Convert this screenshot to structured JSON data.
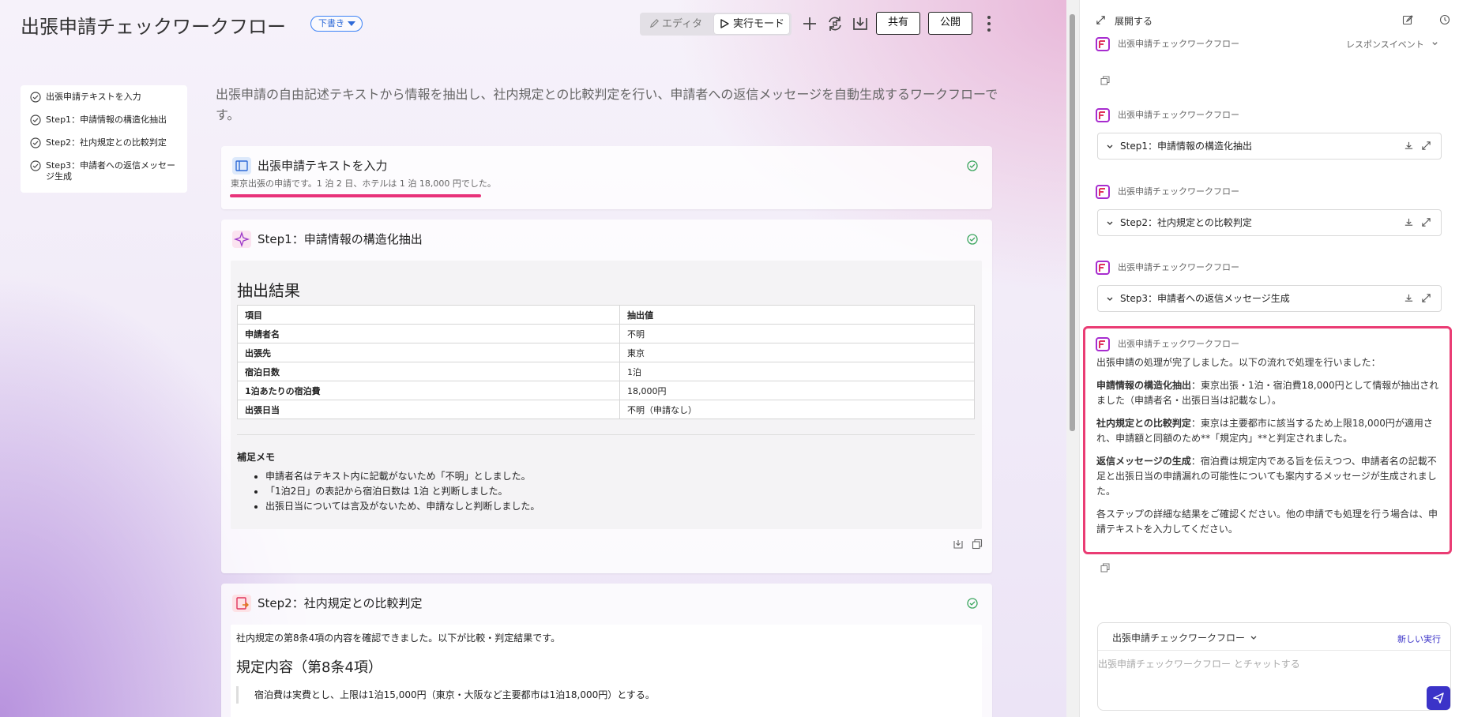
{
  "header": {
    "title": "出張申請チェックワークフロー",
    "status_badge": "下書き",
    "mode_editor": "エディタ",
    "mode_run": "実行モード",
    "share_label": "共有",
    "publish_label": "公開"
  },
  "toc": {
    "items": [
      "出張申請テキストを入力",
      "Step1：申請情報の構造化抽出",
      "Step2：社内規定との比較判定",
      "Step3：申請者への返信メッセージ生成"
    ]
  },
  "main": {
    "description": "出張申請の自由記述テキストから情報を抽出し、社内規定との比較判定を行い、申請者への返信メッセージを自動生成するワークフローです。",
    "input_card": {
      "title": "出張申請テキストを入力",
      "text": "東京出張の申請です。1 泊 2 日、ホテルは 1 泊 18,000 円でした。"
    },
    "step1": {
      "title": "Step1：申請情報の構造化抽出",
      "heading": "抽出結果",
      "table_headers": [
        "項目",
        "抽出値"
      ],
      "rows": [
        [
          "申請者名",
          "不明"
        ],
        [
          "出張先",
          "東京"
        ],
        [
          "宿泊日数",
          "1泊"
        ],
        [
          "1泊あたりの宿泊費",
          "18,000円"
        ],
        [
          "出張日当",
          "不明（申請なし）"
        ]
      ],
      "memo_heading": "補足メモ",
      "memo_items": [
        "申請者名はテキスト内に記載がないため「不明」としました。",
        "「1泊2日」の表記から宿泊日数は 1泊 と判断しました。",
        "出張日当については言及がないため、申請なしと判断しました。"
      ]
    },
    "step2": {
      "title": "Step2：社内規定との比較判定",
      "intro": "社内規定の第8条4項の内容を確認できました。以下が比較・判定結果です。",
      "heading": "規定内容（第8条4項）",
      "quote": "宿泊費は実費とし、上限は1泊15,000円（東京・大阪など主要都市は1泊18,000円）とする。"
    }
  },
  "right_panel": {
    "expand_label": "展開する",
    "top_label": "出張申請チェックワークフロー",
    "top_event": "レスポンスイベント",
    "workflow_label": "出張申請チェックワークフロー",
    "steps": [
      "Step1：申請情報の構造化抽出",
      "Step2：社内規定との比較判定",
      "Step3：申請者への返信メッセージ生成"
    ],
    "result": {
      "label": "出張申請チェックワークフロー",
      "intro": "出張申請の処理が完了しました。以下の流れで処理を行いました：",
      "p1_bold": "申請情報の構造化抽出",
      "p1_text": "：東京出張・1泊・宿泊費18,000円として情報が抽出されました（申請者名・出張日当は記載なし）。",
      "p2_bold": "社内規定との比較判定",
      "p2_text": "：東京は主要都市に該当するため上限18,000円が適用され、申請額と同額のため**「規定内」**と判定されました。",
      "p3_bold": "返信メッセージの生成",
      "p3_text": "：宿泊費は規定内である旨を伝えつつ、申請者名の記載不足と出張日当の申請漏れの可能性についても案内するメッセージが生成されました。",
      "closing": "各ステップの詳細な結果をご確認ください。他の申請でも処理を行う場合は、申請テキストを入力してください。"
    },
    "chat": {
      "selector": "出張申請チェックワークフロー",
      "new_run": "新しい実行",
      "placeholder": "出張申請チェックワークフロー とチャットする"
    }
  },
  "colors": {
    "accent": "#3b33c8",
    "highlight": "#ea3c74",
    "success": "#3aa55d",
    "badge": "#2f6bd8"
  },
  "icons": [
    "pencil-icon",
    "play-icon",
    "plus-icon",
    "sync-icon",
    "download-icon",
    "more-icon",
    "check-circle-icon",
    "input-icon",
    "sparkle-icon",
    "rule-icon",
    "expand-icon",
    "edit-icon",
    "history-icon",
    "app-logo-icon",
    "chevron-down-icon",
    "copy-icon",
    "send-icon"
  ]
}
